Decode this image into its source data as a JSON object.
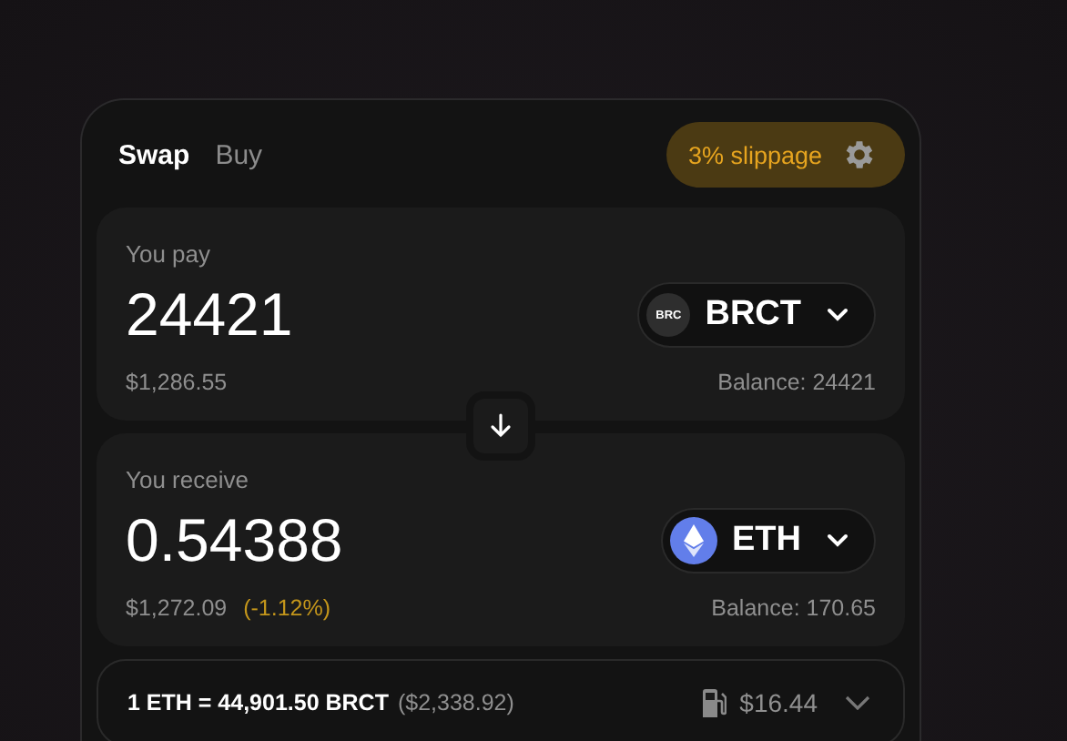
{
  "tabs": [
    {
      "label": "Swap",
      "selected": true
    },
    {
      "label": "Buy",
      "selected": false
    }
  ],
  "slippage": {
    "label": "3% slippage"
  },
  "panels": [
    {
      "label": "You pay",
      "amount": "24421",
      "token": {
        "kind": "brc",
        "icon_text": "BRC",
        "symbol": "BRCT"
      },
      "usd": "$1,286.55",
      "balance": "Balance: 24421"
    },
    {
      "label": "You receive",
      "amount": "0.54388",
      "token": {
        "kind": "eth",
        "symbol": "ETH"
      },
      "usd": "$1,272.09",
      "change": "(-1.12%)",
      "balance": "Balance: 170.65"
    }
  ],
  "rate": {
    "text": "1 ETH = 44,901.50 BRCT",
    "usd": "($2,338.92)",
    "gas": "$16.44"
  }
}
